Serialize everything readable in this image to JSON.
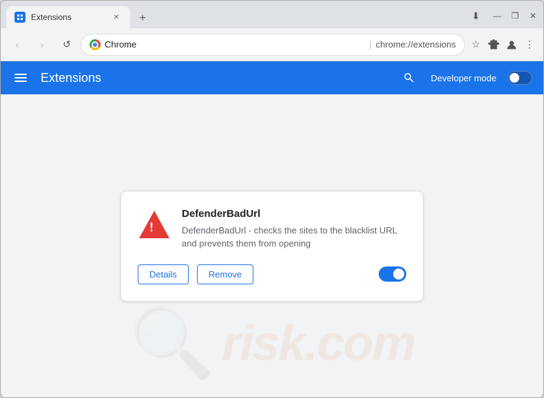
{
  "window": {
    "tab_title": "Extensions",
    "tab_favicon": "puzzle",
    "new_tab_icon": "+",
    "address_site": "Chrome",
    "address_url": "chrome://extensions",
    "nav": {
      "back": "‹",
      "forward": "›",
      "reload": "↺"
    },
    "os_controls": {
      "minimize": "—",
      "maximize": "❐",
      "close": "✕"
    },
    "toolbar_icons": {
      "bookmark": "☆",
      "extensions": "🧩",
      "profile": "👤",
      "menu": "⋮"
    },
    "download_icon": "⬇"
  },
  "extensions_page": {
    "title": "Extensions",
    "search_icon": "🔍",
    "developer_mode_label": "Developer mode",
    "developer_mode_on": false
  },
  "extension_card": {
    "name": "DefenderBadUrl",
    "description": "DefenderBadUrl - checks the sites to the blacklist URL and prevents them from opening",
    "details_button": "Details",
    "remove_button": "Remove",
    "enabled": true
  },
  "watermark": {
    "text": "risk.com"
  }
}
